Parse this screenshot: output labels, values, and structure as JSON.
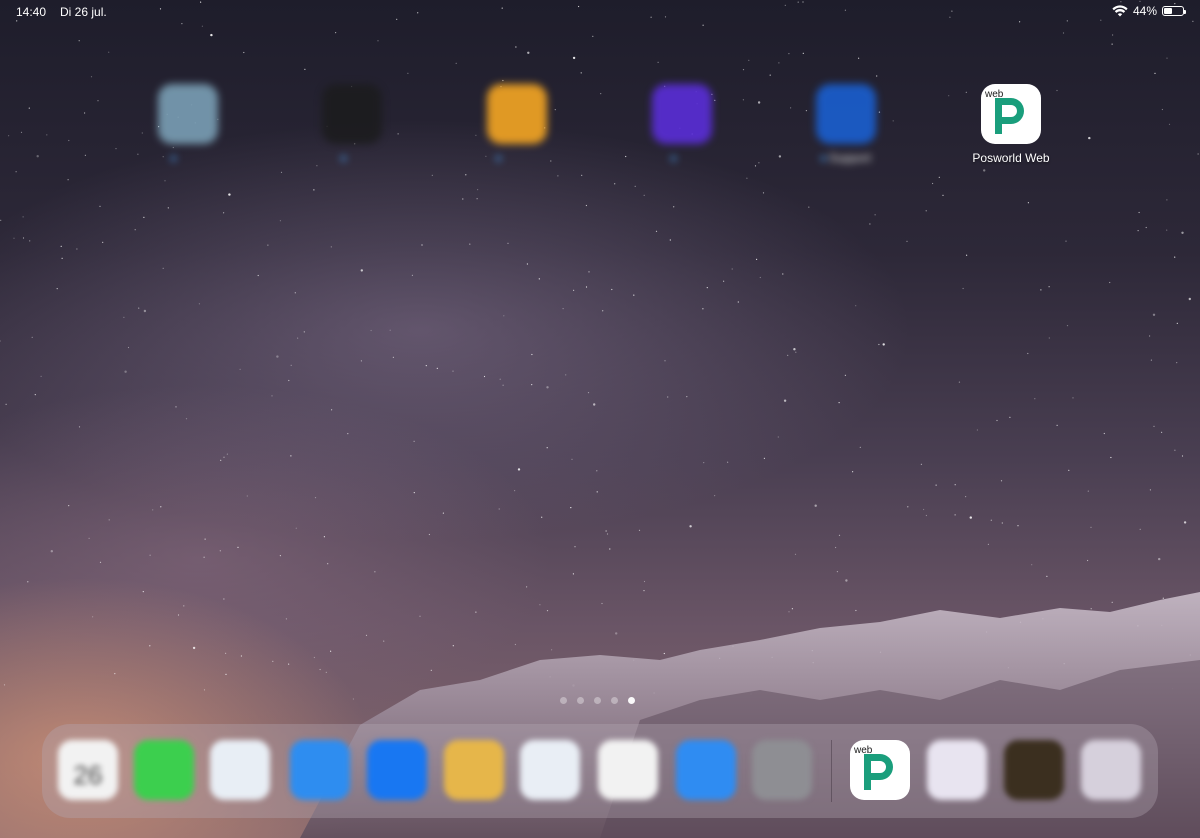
{
  "status_bar": {
    "time": "14:40",
    "date": "Di 26 jul.",
    "battery_percent": "44%",
    "battery_level": 0.44
  },
  "home_apps": [
    {
      "label": "",
      "color": "#7a9fb5",
      "blurred": true,
      "name": "app-1"
    },
    {
      "label": "",
      "color": "#1c1c1e",
      "blurred": true,
      "name": "app-2"
    },
    {
      "label": "",
      "color": "#f5a623",
      "blurred": true,
      "name": "app-3"
    },
    {
      "label": "",
      "color": "#5a2ed8",
      "blurred": true,
      "name": "app-4"
    },
    {
      "label": "Support",
      "color": "#1a5fd0",
      "blurred": true,
      "name": "support"
    },
    {
      "label": "Posworld Web",
      "color": "#ffffff",
      "blurred": false,
      "name": "posworld-web"
    }
  ],
  "posworld_icon": {
    "badge_text": "web",
    "letter": "P",
    "green": "#1a9e7c"
  },
  "page_indicator": {
    "total": 5,
    "active": 4
  },
  "dock": [
    {
      "name": "calendar",
      "color": "#f2f2f2",
      "text": "26"
    },
    {
      "name": "messages",
      "color": "#3ccf4e"
    },
    {
      "name": "outlook",
      "color": "#e8eef5"
    },
    {
      "name": "mail",
      "color": "#2e8df0"
    },
    {
      "name": "facebook",
      "color": "#1877f2"
    },
    {
      "name": "app-gold",
      "color": "#e6b64a"
    },
    {
      "name": "safari",
      "color": "#e9eef5"
    },
    {
      "name": "youtube",
      "color": "#f2f2f2"
    },
    {
      "name": "app-blue",
      "color": "#2f8cf2"
    },
    {
      "name": "settings",
      "color": "#8e8e93"
    },
    {
      "name": "posworld-web-dock",
      "color": "#ffffff"
    },
    {
      "name": "messenger",
      "color": "#e8e4f0"
    },
    {
      "name": "app-dark",
      "color": "#3b2f1f"
    },
    {
      "name": "app-folder",
      "color": "#d6d0dc"
    }
  ]
}
